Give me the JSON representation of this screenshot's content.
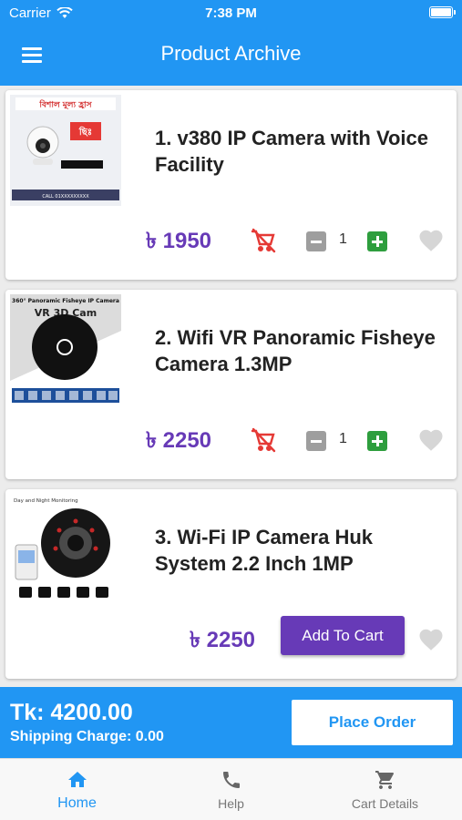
{
  "status": {
    "carrier": "Carrier",
    "time": "7:38 PM"
  },
  "header": {
    "title": "Product Archive"
  },
  "currency_symbol": "৳",
  "products": [
    {
      "name": "1. v380 IP Camera with Voice Facility",
      "price": "৳ 1950",
      "quantity": "1",
      "in_cart": true,
      "thumb": {
        "banner": "বিশাল মূল্য হ্রাস",
        "badge": "ছিঃ",
        "footer": "CALL 01XXXXXXXXX"
      }
    },
    {
      "name": "2. Wifi VR Panoramic Fisheye Camera 1.3MP",
      "price": "৳ 2250",
      "quantity": "1",
      "in_cart": true,
      "thumb": {
        "caption": "360° Panoramic Fisheye IP Camera",
        "label": "VR 3D Cam"
      }
    },
    {
      "name": "3. Wi-Fi IP Camera Huk System 2.2 Inch 1MP",
      "price": "৳ 2250",
      "in_cart": false,
      "add_label": "Add To Cart",
      "thumb": {
        "caption": "Day and Night Monitoring"
      }
    }
  ],
  "summary": {
    "total": "Tk: 4200.00",
    "shipping": "Shipping Charge: 0.00",
    "place_order": "Place Order"
  },
  "tabs": [
    {
      "label": "Home",
      "icon": "home-icon",
      "active": true
    },
    {
      "label": "Help",
      "icon": "phone-icon",
      "active": false
    },
    {
      "label": "Cart Details",
      "icon": "cart-icon",
      "active": false
    }
  ],
  "colors": {
    "primary": "#2196f3",
    "price": "#673ab7",
    "add_button": "#673ab7",
    "remove": "#e53935",
    "plus": "#2e9e3e",
    "minus": "#9e9e9e"
  }
}
